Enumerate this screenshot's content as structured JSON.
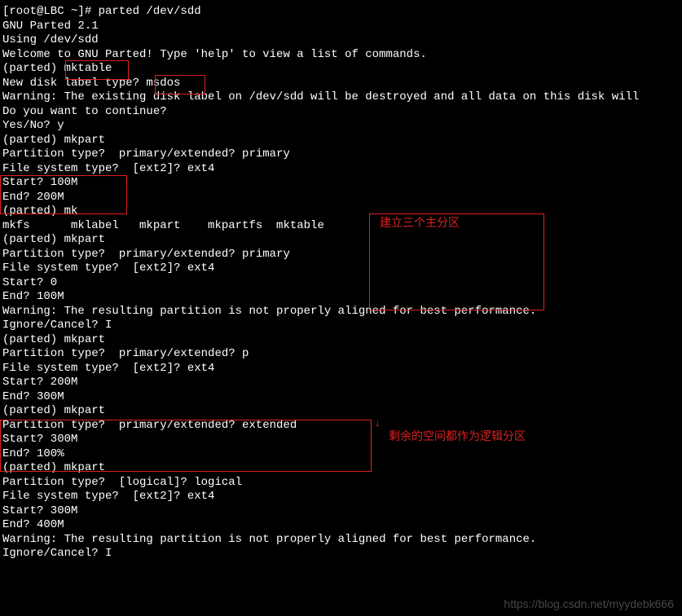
{
  "lines": [
    "[root@LBC ~]# parted /dev/sdd",
    "GNU Parted 2.1",
    "Using /dev/sdd",
    "Welcome to GNU Parted! Type 'help' to view a list of commands.",
    "(parted) mktable",
    "New disk label type? msdos",
    "Warning: The existing disk label on /dev/sdd will be destroyed and all data on this disk will",
    "Do you want to continue?",
    "Yes/No? y",
    "(parted) mkpart",
    "Partition type?  primary/extended? primary",
    "File system type?  [ext2]? ext4",
    "Start? 100M",
    "End? 200M",
    "(parted) mk",
    "mkfs      mklabel   mkpart    mkpartfs  mktable   ",
    "(parted) mkpart",
    "Partition type?  primary/extended? primary",
    "File system type?  [ext2]? ext4",
    "Start? 0",
    "End? 100M",
    "Warning: The resulting partition is not properly aligned for best performance.",
    "Ignore/Cancel? I",
    "(parted) mkpart",
    "Partition type?  primary/extended? p",
    "File system type?  [ext2]? ext4",
    "Start? 200M",
    "End? 300M",
    "(parted) mkpart",
    "Partition type?  primary/extended? extended",
    "Start? 300M",
    "End? 100%",
    "(parted) mkpart",
    "Partition type?  [logical]? logical",
    "File system type?  [ext2]? ext4",
    "Start? 300M",
    "End? 400M",
    "Warning: The resulting partition is not properly aligned for best performance.",
    "Ignore/Cancel? I"
  ],
  "annotations": {
    "box1_label": "建立三个主分区",
    "box2_label": "剩余的空间都作为逻辑分区"
  },
  "watermark": "https://blog.csdn.net/myydebk666"
}
